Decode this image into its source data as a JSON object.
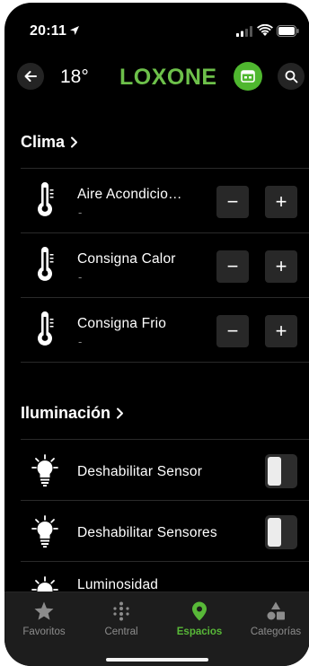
{
  "status_bar": {
    "time": "20:11"
  },
  "header": {
    "temperature": "18°",
    "logo": "LOXONE"
  },
  "sections": {
    "clima": {
      "title": "Clima",
      "rows": [
        {
          "label": "Aire Acondicio…",
          "value": "-",
          "icon": "thermometer-icon"
        },
        {
          "label": "Consigna Calor",
          "value": "-",
          "icon": "thermometer-icon"
        },
        {
          "label": "Consigna Frio",
          "value": "-",
          "icon": "thermometer-icon"
        }
      ],
      "minus_symbol": "−",
      "plus_symbol": "+"
    },
    "iluminacion": {
      "title": "Iluminación",
      "rows": [
        {
          "label": "Deshabilitar Sensor",
          "icon": "lightbulb-icon",
          "toggle_on": false
        },
        {
          "label": "Deshabilitar Sensores",
          "icon": "lightbulb-icon",
          "toggle_on": false
        },
        {
          "label": "Luminosidad",
          "icon": "lightbulb-icon"
        }
      ]
    }
  },
  "tabs": [
    {
      "label": "Favoritos",
      "icon": "star-icon",
      "active": false
    },
    {
      "label": "Central",
      "icon": "grid-dots-icon",
      "active": false
    },
    {
      "label": "Espacios",
      "icon": "location-pin-icon",
      "active": true
    },
    {
      "label": "Categorías",
      "icon": "shapes-icon",
      "active": false
    }
  ],
  "colors": {
    "accent": "#6dc04a",
    "active_tab": "#58b838",
    "background": "#000000",
    "tabbar": "#1d1d1d"
  }
}
